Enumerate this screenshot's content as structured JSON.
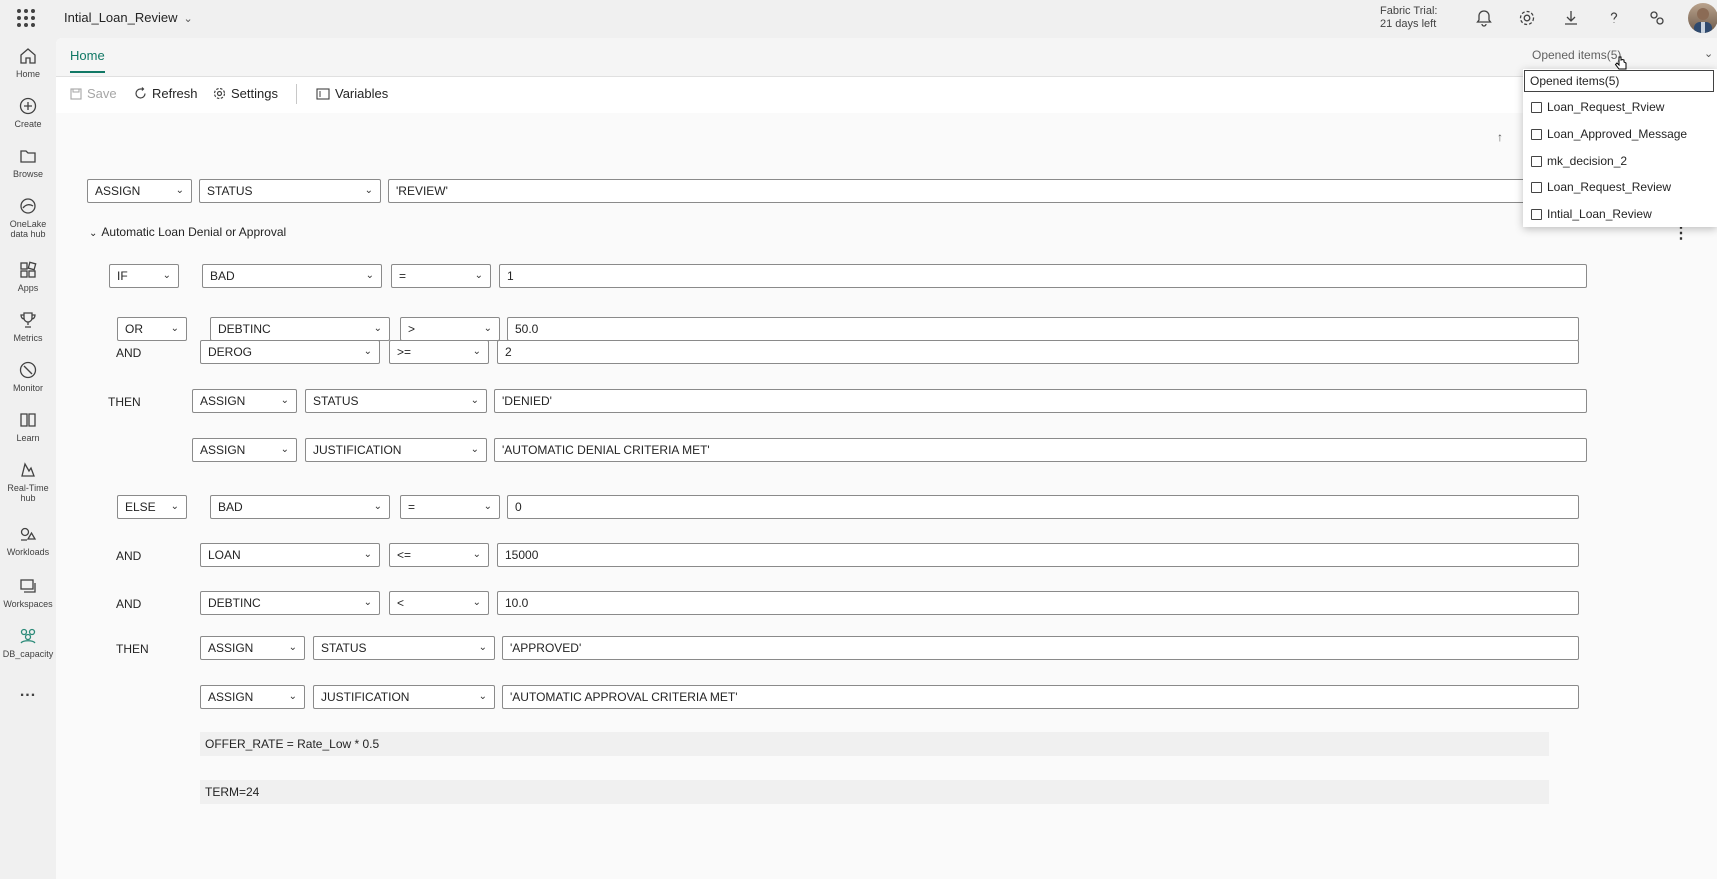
{
  "app": {
    "title": "Intial_Loan_Review"
  },
  "trial": {
    "line1": "Fabric Trial:",
    "line2": "21 days left"
  },
  "sidebar": {
    "items": [
      {
        "label": "Home",
        "icon": "home-icon"
      },
      {
        "label": "Create",
        "icon": "plus-circle-icon"
      },
      {
        "label": "Browse",
        "icon": "folder-icon"
      },
      {
        "label": "OneLake data hub",
        "icon": "onelake-icon"
      },
      {
        "label": "Apps",
        "icon": "apps-icon"
      },
      {
        "label": "Metrics",
        "icon": "trophy-icon"
      },
      {
        "label": "Monitor",
        "icon": "monitor-icon"
      },
      {
        "label": "Learn",
        "icon": "book-icon"
      },
      {
        "label": "Real-Time hub",
        "icon": "realtime-icon"
      },
      {
        "label": "Workloads",
        "icon": "workloads-icon"
      },
      {
        "label": "Workspaces",
        "icon": "workspaces-icon"
      },
      {
        "label": "DB_capacity",
        "icon": "capacity-icon"
      }
    ],
    "more": "..."
  },
  "tabs": {
    "home": "Home",
    "opened_items": "Opened items(5)"
  },
  "toolbar": {
    "save": "Save",
    "refresh": "Refresh",
    "settings": "Settings",
    "variables": "Variables"
  },
  "rule": {
    "top_assign": {
      "action": "ASSIGN",
      "variable": "STATUS",
      "value": "'REVIEW'"
    },
    "group_title": "Automatic Loan Denial or Approval",
    "if1": {
      "kw": "IF",
      "var": "BAD",
      "op": "=",
      "val": "1"
    },
    "or1": {
      "kw": "OR",
      "var": "DEBTINC",
      "op": ">",
      "val": "50.0"
    },
    "and1": {
      "kw": "AND",
      "var": "DEROG",
      "op": ">=",
      "val": "2"
    },
    "then1": {
      "kw": "THEN",
      "action": "ASSIGN",
      "var": "STATUS",
      "val": "'DENIED'"
    },
    "then1b": {
      "action": "ASSIGN",
      "var": "JUSTIFICATION",
      "val": "'AUTOMATIC DENIAL CRITERIA MET'"
    },
    "else1": {
      "kw": "ELSE",
      "var": "BAD",
      "op": "=",
      "val": "0"
    },
    "and2": {
      "kw": "AND",
      "var": "LOAN",
      "op": "<=",
      "val": "15000"
    },
    "and3": {
      "kw": "AND",
      "var": "DEBTINC",
      "op": "<",
      "val": "10.0"
    },
    "then2": {
      "kw": "THEN",
      "action": "ASSIGN",
      "var": "STATUS",
      "val": "'APPROVED'"
    },
    "then2b": {
      "action": "ASSIGN",
      "var": "JUSTIFICATION",
      "val": "'AUTOMATIC APPROVAL CRITERIA MET'"
    },
    "expr1": "OFFER_RATE = Rate_Low * 0.5",
    "expr2": "TERM=24"
  },
  "opened_items": {
    "header": "Opened items(5)",
    "items": [
      {
        "label": "Loan_Request_Rview",
        "icon": "decision-icon"
      },
      {
        "label": "Loan_Approved_Message",
        "icon": "message-icon"
      },
      {
        "label": "mk_decision_2",
        "icon": "decision-icon"
      },
      {
        "label": "Loan_Request_Review",
        "icon": "decision-icon"
      },
      {
        "label": "Intial_Loan_Review",
        "icon": "ruleset-icon"
      }
    ]
  }
}
